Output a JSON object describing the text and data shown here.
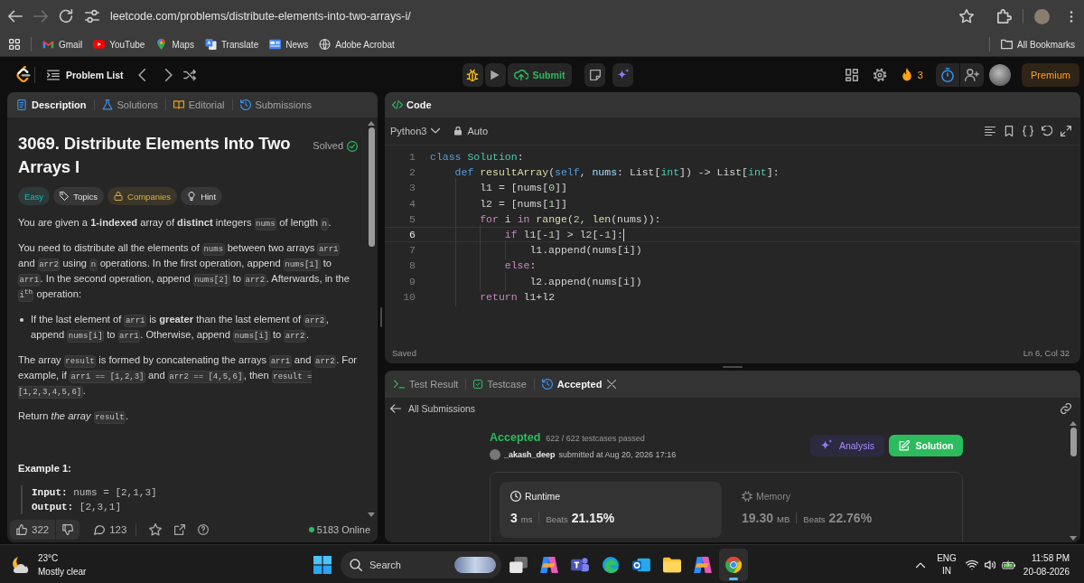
{
  "browser": {
    "back_enabled": true,
    "forward_enabled": false,
    "url": "leetcode.com/problems/distribute-elements-into-two-arrays-i/",
    "bookmarks": [
      {
        "kind": "mail",
        "label": "Gmail"
      },
      {
        "kind": "video",
        "label": "YouTube"
      },
      {
        "kind": "map",
        "label": "Maps"
      },
      {
        "kind": "translate",
        "label": "Translate"
      },
      {
        "kind": "news",
        "label": "News"
      },
      {
        "kind": "globe",
        "label": "Adobe Acrobat"
      }
    ],
    "all_bookmarks": "All Bookmarks"
  },
  "nav": {
    "problem_list": "Problem List",
    "submit": "Submit",
    "streak": "3",
    "premium": "Premium"
  },
  "description": {
    "tabs": [
      {
        "label": "Description",
        "selected": true
      },
      {
        "label": "Solutions",
        "selected": false
      },
      {
        "label": "Editorial",
        "selected": false
      },
      {
        "label": "Submissions",
        "selected": false
      }
    ],
    "title": "3069. Distribute Elements Into Two Arrays I",
    "status": "Solved",
    "tags": [
      {
        "kind": "difficulty",
        "label": "Easy"
      },
      {
        "kind": "topics",
        "label": "Topics"
      },
      {
        "kind": "companies",
        "label": "Companies"
      },
      {
        "kind": "hint",
        "label": "Hint"
      }
    ],
    "blocks": [
      {
        "kind": "paragraph",
        "segments": [
          {
            "kind": "text",
            "text": "You are given a **1-indexed** array of **distinct** integers "
          },
          {
            "kind": "code",
            "text": "nums"
          },
          {
            "kind": "text",
            "text": " of length "
          },
          {
            "kind": "code",
            "text": "n"
          },
          {
            "kind": "text",
            "text": "."
          }
        ]
      },
      {
        "kind": "paragraph",
        "segments": [
          {
            "kind": "text",
            "text": "You need to distribute all the elements of "
          },
          {
            "kind": "code",
            "text": "nums"
          },
          {
            "kind": "text",
            "text": " between two arrays "
          },
          {
            "kind": "code",
            "text": "arr1"
          },
          {
            "kind": "text",
            "text": " and "
          },
          {
            "kind": "code",
            "text": "arr2"
          },
          {
            "kind": "text",
            "text": " using "
          },
          {
            "kind": "code",
            "text": "n"
          },
          {
            "kind": "text",
            "text": " operations. In the first operation, append "
          },
          {
            "kind": "code",
            "text": "nums[1]"
          },
          {
            "kind": "text",
            "text": " to "
          },
          {
            "kind": "code",
            "text": "arr1"
          },
          {
            "kind": "text",
            "text": ". In the second operation, append "
          },
          {
            "kind": "code",
            "text": "nums[2]"
          },
          {
            "kind": "text",
            "text": " to "
          },
          {
            "kind": "code",
            "text": "arr2"
          },
          {
            "kind": "text",
            "text": ". Afterwards, in the "
          },
          {
            "kind": "code",
            "text": "i$^{th}$"
          },
          {
            "kind": "text",
            "text": " operation:"
          }
        ]
      },
      {
        "kind": "bullet",
        "segments": [
          {
            "kind": "text",
            "text": "If the last element of "
          },
          {
            "kind": "code",
            "text": "arr1"
          },
          {
            "kind": "text",
            "text": " is **greater** than the last element of "
          },
          {
            "kind": "code",
            "text": "arr2"
          },
          {
            "kind": "text",
            "text": ", append "
          },
          {
            "kind": "code",
            "text": "nums[i]"
          },
          {
            "kind": "text",
            "text": " to "
          },
          {
            "kind": "code",
            "text": "arr1"
          },
          {
            "kind": "text",
            "text": ". Otherwise, append "
          },
          {
            "kind": "code",
            "text": "nums[i]"
          },
          {
            "kind": "text",
            "text": " to "
          },
          {
            "kind": "code",
            "text": "arr2"
          },
          {
            "kind": "text",
            "text": "."
          }
        ]
      },
      {
        "kind": "paragraph",
        "segments": [
          {
            "kind": "text",
            "text": "The array "
          },
          {
            "kind": "code",
            "text": "result"
          },
          {
            "kind": "text",
            "text": " is formed by concatenating the arrays "
          },
          {
            "kind": "code",
            "text": "arr1"
          },
          {
            "kind": "text",
            "text": " and "
          },
          {
            "kind": "code",
            "text": "arr2"
          },
          {
            "kind": "text",
            "text": ". For example, if "
          },
          {
            "kind": "code",
            "text": "arr1 == [1,2,3]"
          },
          {
            "kind": "text",
            "text": " and "
          },
          {
            "kind": "code",
            "text": "arr2 == [4,5,6]"
          },
          {
            "kind": "text",
            "text": ", then "
          },
          {
            "kind": "code",
            "text": "result = [1,2,3,4,5,6]"
          },
          {
            "kind": "text",
            "text": "."
          }
        ]
      },
      {
        "kind": "paragraph",
        "segments": [
          {
            "kind": "text",
            "text": "Return *the array* "
          },
          {
            "kind": "code",
            "text": "result"
          },
          {
            "kind": "text",
            "text": "."
          }
        ]
      }
    ],
    "example": {
      "heading": "Example 1:",
      "lines": [
        {
          "label": "Input:",
          "value": "nums = [2,1,3]"
        },
        {
          "label": "Output:",
          "value": "[2,3,1]"
        }
      ]
    },
    "footer": {
      "likes": "322",
      "comments": "123",
      "online": "5183 Online"
    }
  },
  "editor": {
    "title": "Code",
    "language": "Python3",
    "mode": "Auto",
    "lines": [
      {
        "number": "1",
        "current": false,
        "tokens": [
          {
            "text": "class ",
            "kind": "keyword"
          },
          {
            "text": "Solution",
            "kind": "type"
          },
          {
            "text": ":",
            "kind": "plain"
          }
        ]
      },
      {
        "number": "2",
        "current": false,
        "tokens": [
          {
            "text": "    def ",
            "kind": "keyword"
          },
          {
            "text": "resultArray",
            "kind": "function"
          },
          {
            "text": "(",
            "kind": "plain"
          },
          {
            "text": "self",
            "kind": "keyword"
          },
          {
            "text": ", ",
            "kind": "plain"
          },
          {
            "text": "nums",
            "kind": "parameter"
          },
          {
            "text": ": List[",
            "kind": "plain"
          },
          {
            "text": "int",
            "kind": "type"
          },
          {
            "text": "]) -> List[",
            "kind": "plain"
          },
          {
            "text": "int",
            "kind": "type"
          },
          {
            "text": "]:",
            "kind": "plain"
          }
        ]
      },
      {
        "number": "3",
        "current": false,
        "tokens": [
          {
            "text": "        l1 = [nums[",
            "kind": "plain"
          },
          {
            "text": "0",
            "kind": "number"
          },
          {
            "text": "]]",
            "kind": "plain"
          }
        ]
      },
      {
        "number": "4",
        "current": false,
        "tokens": [
          {
            "text": "        l2 = [nums[",
            "kind": "plain"
          },
          {
            "text": "1",
            "kind": "number"
          },
          {
            "text": "]]",
            "kind": "plain"
          }
        ]
      },
      {
        "number": "5",
        "current": false,
        "tokens": [
          {
            "text": "        for ",
            "kind": "control"
          },
          {
            "text": "i ",
            "kind": "plain"
          },
          {
            "text": "in ",
            "kind": "control"
          },
          {
            "text": "range",
            "kind": "function"
          },
          {
            "text": "(",
            "kind": "plain"
          },
          {
            "text": "2",
            "kind": "number"
          },
          {
            "text": ", ",
            "kind": "plain"
          },
          {
            "text": "len",
            "kind": "function"
          },
          {
            "text": "(nums)):",
            "kind": "plain"
          }
        ]
      },
      {
        "number": "6",
        "current": true,
        "tokens": [
          {
            "text": "            if ",
            "kind": "control"
          },
          {
            "text": "l1[-",
            "kind": "plain"
          },
          {
            "text": "1",
            "kind": "number"
          },
          {
            "text": "] > l2[-",
            "kind": "plain"
          },
          {
            "text": "1",
            "kind": "number"
          },
          {
            "text": "]:",
            "kind": "plain"
          }
        ]
      },
      {
        "number": "7",
        "current": false,
        "tokens": [
          {
            "text": "                l1.append(nums[i])",
            "kind": "plain"
          }
        ]
      },
      {
        "number": "8",
        "current": false,
        "tokens": [
          {
            "text": "            else",
            "kind": "control"
          },
          {
            "text": ":",
            "kind": "plain"
          }
        ]
      },
      {
        "number": "9",
        "current": false,
        "tokens": [
          {
            "text": "                l2.append(nums[i])",
            "kind": "plain"
          }
        ]
      },
      {
        "number": "10",
        "current": false,
        "tokens": [
          {
            "text": "        return ",
            "kind": "control"
          },
          {
            "text": "l1+l2",
            "kind": "plain"
          }
        ]
      }
    ],
    "status": "Saved",
    "cursor": "Ln 6, Col 32"
  },
  "result": {
    "tabs": [
      {
        "label": "Test Result",
        "selected": false,
        "closable": false
      },
      {
        "label": "Testcase",
        "selected": false,
        "closable": false
      },
      {
        "label": "Accepted",
        "selected": true,
        "closable": true
      }
    ],
    "back": "All Submissions",
    "status": "Accepted",
    "testcases": "622 / 622 testcases passed",
    "user": "_akash_deep",
    "submitted": "submitted at Aug 20, 2026 17:16",
    "buttons": [
      {
        "kind": "analysis",
        "label": "Analysis"
      },
      {
        "kind": "solution",
        "label": "Solution"
      }
    ],
    "metrics": [
      {
        "kind": "runtime",
        "label": "Runtime",
        "value": "3",
        "unit": "ms",
        "beats_label": "Beats",
        "beats": "21.15%",
        "selected": true
      },
      {
        "kind": "memory",
        "label": "Memory",
        "value": "19.30",
        "unit": "MB",
        "beats_label": "Beats",
        "beats": "22.76%",
        "selected": false
      }
    ]
  },
  "taskbar": {
    "temperature": "23°C",
    "weather": "Mostly clear",
    "search": "Search",
    "apps": [
      {
        "kind": "task-view",
        "selected": false
      },
      {
        "kind": "copilot",
        "selected": false
      },
      {
        "kind": "teams",
        "selected": false
      },
      {
        "kind": "edge",
        "selected": false
      },
      {
        "kind": "outlook",
        "selected": false
      },
      {
        "kind": "files",
        "selected": false
      },
      {
        "kind": "copilot-pc",
        "selected": false
      },
      {
        "kind": "chrome",
        "selected": true
      }
    ],
    "language": "ENG",
    "region": "IN",
    "time": "11:58 PM",
    "date": "20-08-2026"
  }
}
